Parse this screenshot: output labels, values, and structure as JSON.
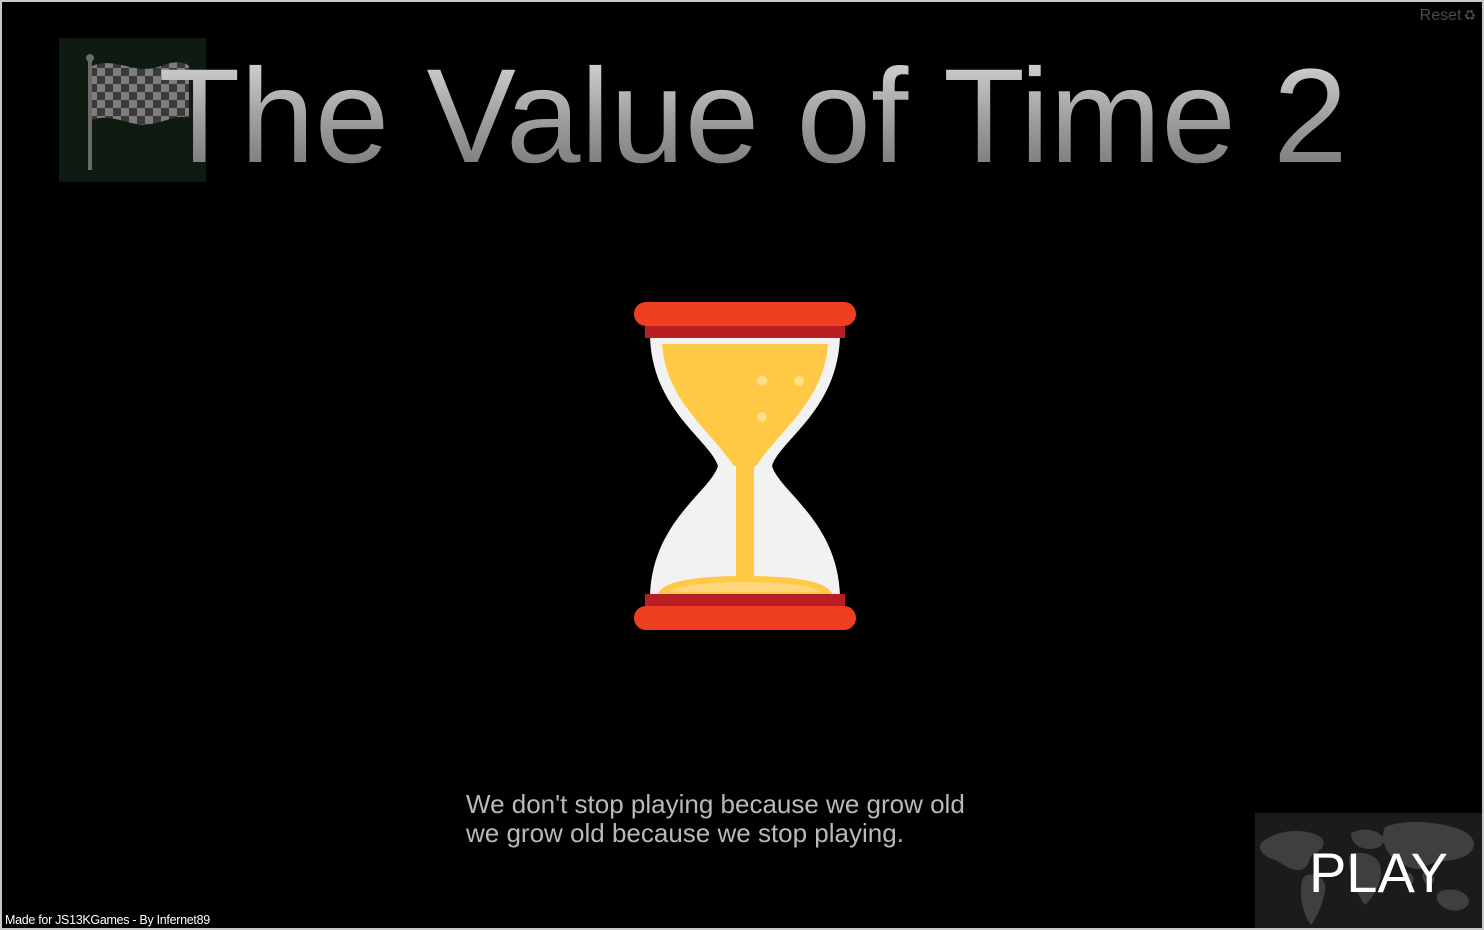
{
  "game": {
    "title": "The Value of Time 2",
    "reset_label": "Reset",
    "reset_icon": "recycle-icon",
    "quote_line1": "We don't stop playing because we grow old",
    "quote_line2": "we grow old because we stop playing.",
    "credit": "Made for JS13KGames - By Infernet89",
    "play_label": "PLAY"
  },
  "icons": {
    "flag": "checkered-flag-icon",
    "hourglass": "hourglass-icon",
    "map": "world-map-icon"
  },
  "colors": {
    "background": "#000000",
    "hourglass_cap": "#ef3e22",
    "hourglass_cap_dark": "#b81e22",
    "sand": "#ffc845",
    "glass": "#f2f2f2"
  }
}
